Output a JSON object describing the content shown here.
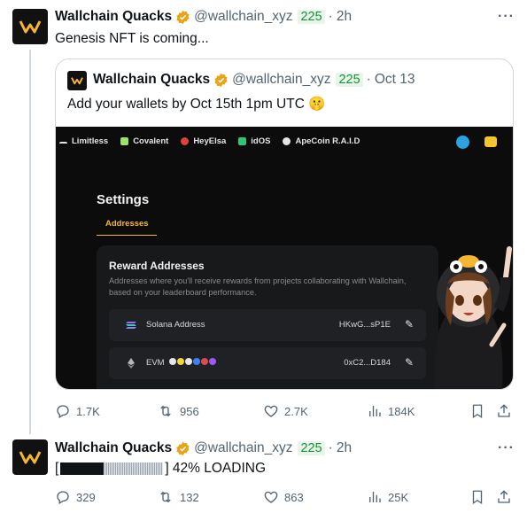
{
  "tweet1": {
    "name": "Wallchain Quacks",
    "handle": "@wallchain_xyz",
    "badge": "225",
    "time": "2h",
    "text": "Genesis NFT is coming...",
    "more": "···",
    "quote": {
      "name": "Wallchain Quacks",
      "handle": "@wallchain_xyz",
      "badge": "225",
      "time": "Oct 13",
      "text": "Add your wallets by Oct 15th 1pm UTC 🤫",
      "media": {
        "partners": [
          "Limitless",
          "Covalent",
          "HeyElsa",
          "idOS",
          "ApeCoin R.A.I.D"
        ],
        "settings_title": "Settings",
        "tab_label": "Addresses",
        "panel_title": "Reward Addresses",
        "panel_desc": "Addresses where you'll receive rewards from projects collaborating with Wallchain, based on your leaderboard performance.",
        "rows": [
          {
            "label": "Solana Address",
            "value": "HKwG...sP1E"
          },
          {
            "label": "EVM",
            "value": "0xC2...D184"
          }
        ]
      }
    },
    "actions": {
      "replies": "1.7K",
      "reposts": "956",
      "likes": "2.7K",
      "views": "184K"
    }
  },
  "tweet2": {
    "name": "Wallchain Quacks",
    "handle": "@wallchain_xyz",
    "badge": "225",
    "time": "2h",
    "text_prefix": "[",
    "text_suffix": "] 42% LOADING",
    "more": "···",
    "progress": 0.42,
    "actions": {
      "replies": "329",
      "reposts": "132",
      "likes": "863",
      "views": "25K"
    }
  },
  "colors": {
    "accent": "#f5b632",
    "badge_green": "#1a8f3a",
    "verified_gold": "#e8a317",
    "muted": "#536471"
  }
}
